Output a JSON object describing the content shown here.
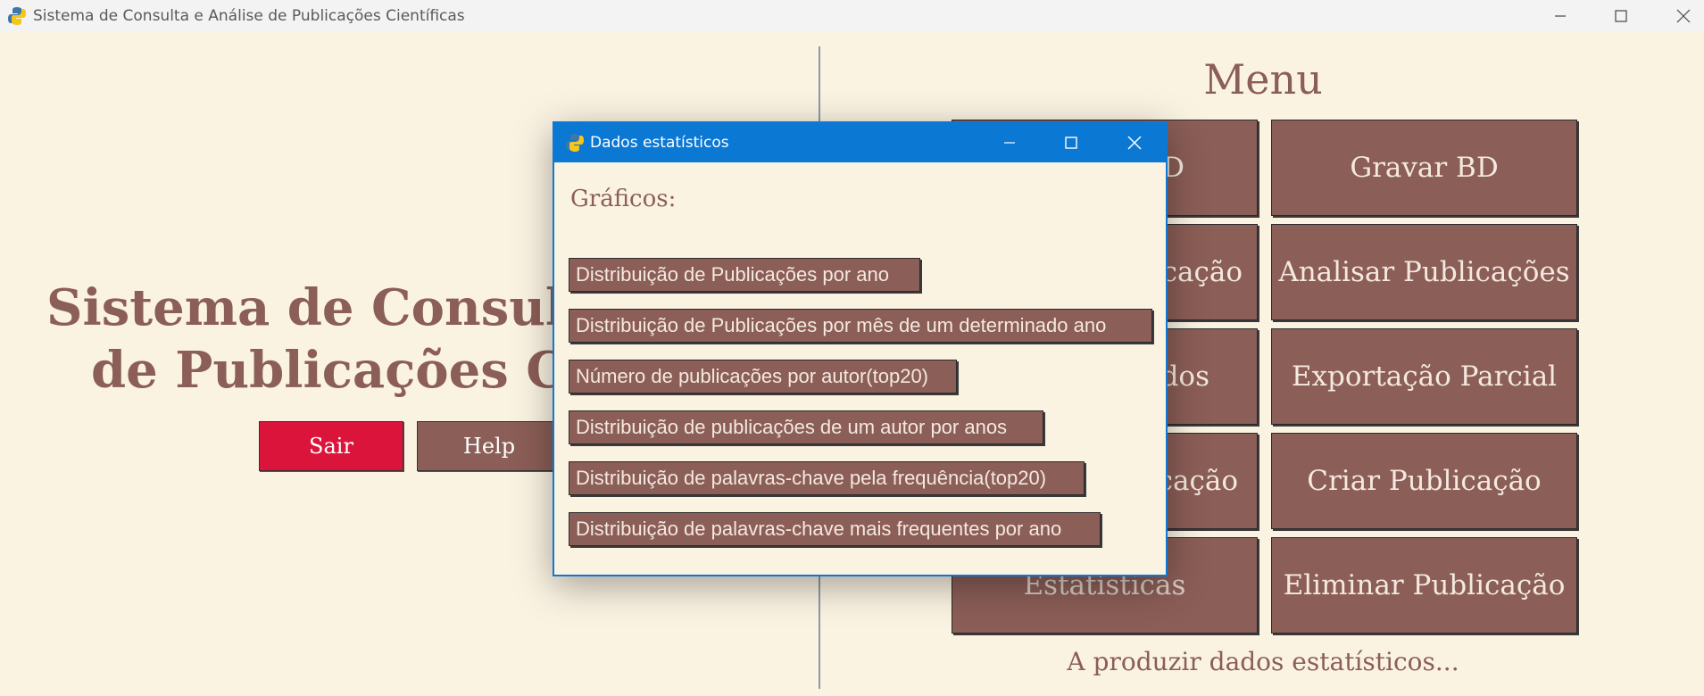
{
  "window": {
    "title": "Sistema de Consulta e Análise de Publicações Científicas",
    "icon": "python-icon"
  },
  "left": {
    "title_line1": "Sistema de Consulta",
    "title_line2": "de Publicações Cien",
    "sair_label": "Sair",
    "help_label": "Help"
  },
  "menu": {
    "title": "Menu",
    "col1": [
      "D",
      "icação",
      "dos",
      "cação",
      "Estatísticas"
    ],
    "col2": [
      "Gravar BD",
      "Analisar Publicações",
      "Exportação Parcial",
      "Criar Publicação",
      "Eliminar Publicação"
    ],
    "status": "A produzir dados estatísticos..."
  },
  "dialog": {
    "title": "Dados estatísticos",
    "heading": "Gráficos:",
    "buttons": [
      "Distribuição de Publicações por ano",
      "Distribuição de Publicações por mês de um determinado ano",
      "Número de publicações por autor(top20)",
      "Distribuição de publicações de um autor por anos",
      "Distribuição de palavras-chave pela frequência(top20)",
      "Distribuição de palavras-chave mais frequentes por ano"
    ]
  },
  "colors": {
    "background": "#fbf3e2",
    "button": "#8b5e57",
    "sair": "#db143c",
    "dialog_titlebar": "#0b78d4"
  }
}
